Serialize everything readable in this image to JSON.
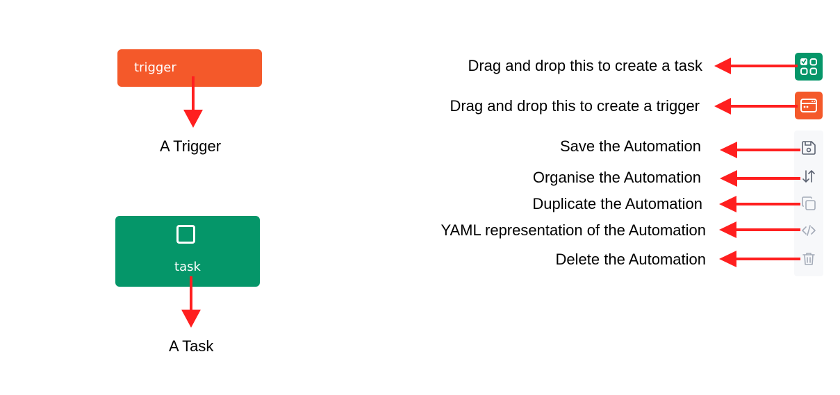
{
  "colors": {
    "trigger": "#f4592a",
    "task": "#059669",
    "arrow": "#ff1f1f",
    "toolbar_icon": "#5b6271",
    "toolbar_icon_muted": "#a4abb8",
    "toolbar_bg": "#f7f8fa"
  },
  "nodes": {
    "trigger": {
      "label": "trigger",
      "caption": "A Trigger"
    },
    "task": {
      "label": "task",
      "caption": "A Task",
      "icon": "checkbox-icon"
    }
  },
  "palette": {
    "task_callout": "Drag and drop this to create a task",
    "task_icon": "task-grid-icon",
    "trigger_callout": "Drag and drop this to create a trigger",
    "trigger_icon": "trigger-window-icon"
  },
  "toolbar": {
    "save": {
      "callout": "Save the Automation",
      "icon": "save-icon"
    },
    "organise": {
      "callout": "Organise the Automation",
      "icon": "sort-arrows-icon"
    },
    "duplicate": {
      "callout": "Duplicate the Automation",
      "icon": "copy-icon"
    },
    "yaml": {
      "callout": "YAML representation of the Automation",
      "icon": "code-icon"
    },
    "delete": {
      "callout": "Delete the Automation",
      "icon": "trash-icon"
    }
  }
}
